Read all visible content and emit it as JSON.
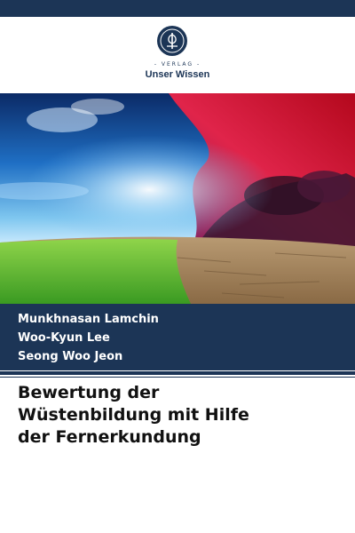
{
  "publisher": {
    "tagline": "VERLAG",
    "name": "Unser Wissen"
  },
  "cover_image": {
    "icon": "desert-and-green-field-under-split-sky-image"
  },
  "authors": [
    "Munkhnasan Lamchin",
    "Woo-Kyun Lee",
    "Seong Woo Jeon"
  ],
  "title_lines": [
    "Bewertung der",
    "Wüstenbildung mit Hilfe",
    "der Fernerkundung"
  ],
  "colors": {
    "brand": "#1c3556",
    "background": "#ffffff",
    "title_text": "#111111"
  }
}
